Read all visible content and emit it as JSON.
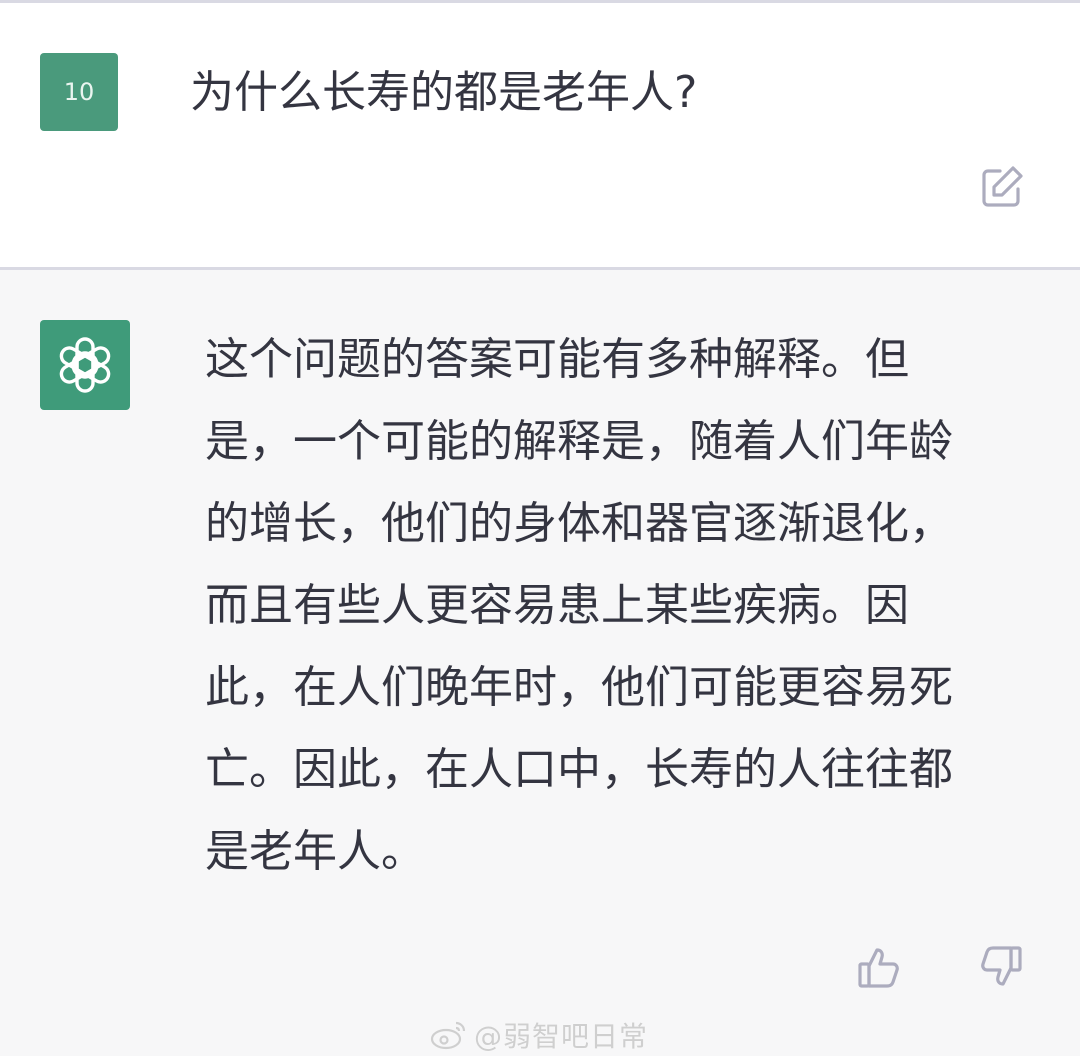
{
  "user": {
    "avatar_text": "10",
    "question": "为什么长寿的都是老年人?"
  },
  "assistant": {
    "answer_lines": [
      "这个问题的答案可能有多种解释。但",
      "是，一个可能的解释是，随着人们年龄",
      "的增长，他们的身体和器官逐渐退化，",
      "而且有些人更容易患上某些疾病。因",
      "此，在人们晚年时，他们可能更容易死",
      "亡。因此，在人口中，长寿的人往往都",
      "是老年人。"
    ]
  },
  "icons": {
    "edit": "edit-icon",
    "avatar": "openai-logo-icon",
    "thumbs_up": "thumbs-up-icon",
    "thumbs_down": "thumbs-down-icon",
    "watermark_logo": "weibo-logo-icon"
  },
  "watermark": {
    "text": "@弱智吧日常"
  },
  "colors": {
    "avatar_green": "#4a9a7c",
    "assistant_bg": "#f7f7f8",
    "text": "#343541",
    "icon_gray": "#acacbe"
  }
}
